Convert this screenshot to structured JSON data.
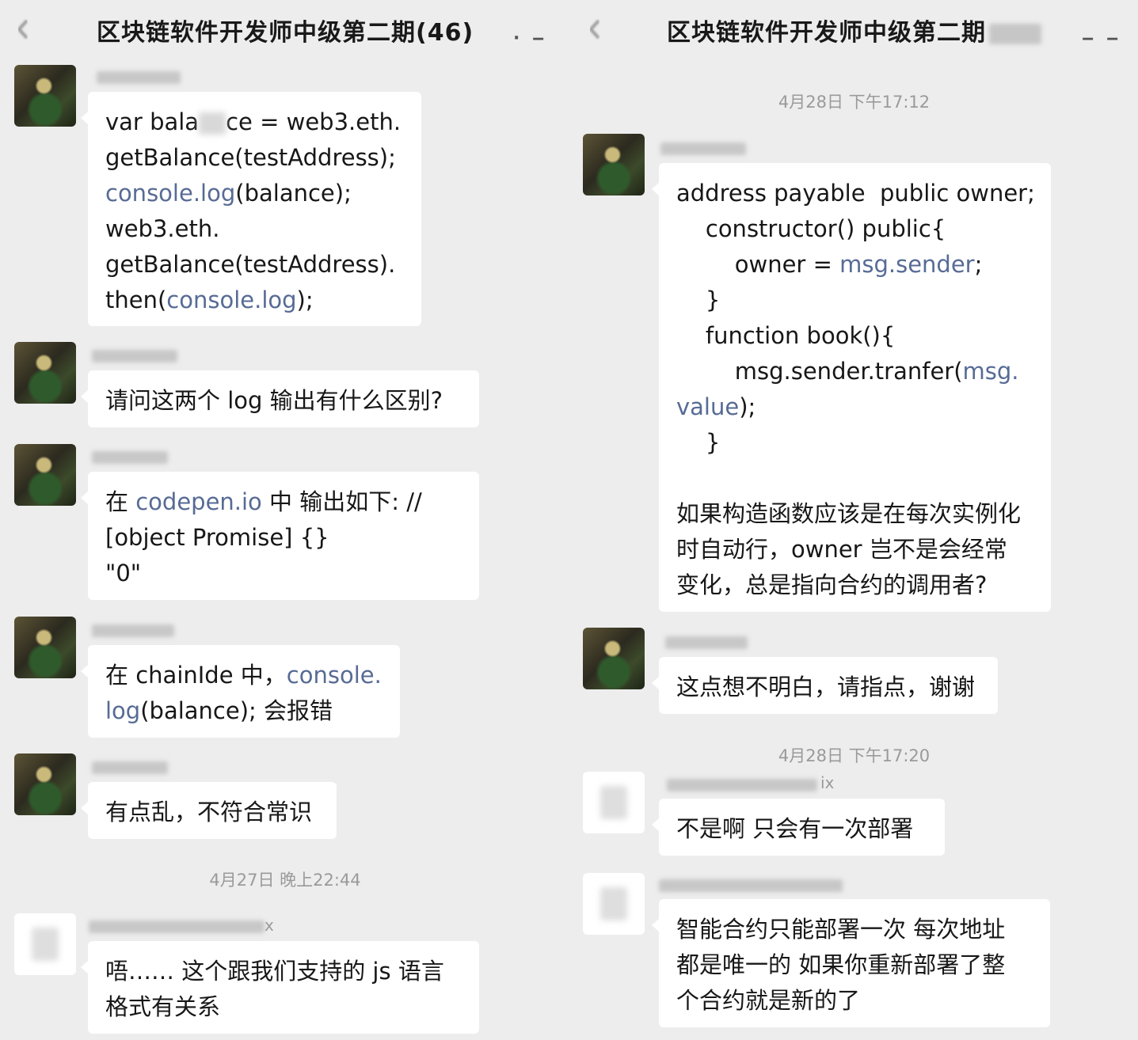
{
  "left": {
    "title": "区块链软件开发师中级第二期(46)",
    "more_icon": "more-dots",
    "timestamp": "4月27日 晚上22:44",
    "messages": [
      {
        "lines": [
          "var bala",
          "ce = web3.eth.",
          "getBala",
          "nce(testAddress);",
          "console",
          "log",
          "(balance);",
          "web3.eth.",
          "getBalance(testAddress).",
          "then(",
          "console.log",
          ");"
        ]
      },
      {
        "text": "请问这两个 log 输出有什么区别?"
      },
      {
        "pre": "在 ",
        "link": "codepen.io",
        "post": " 中 输出如下: //\n[object Promise] {}\n\"0\""
      },
      {
        "pre": "在 chainIde 中，",
        "link": "console.\nlog",
        "post": "(balance); 会报错"
      },
      {
        "text": "有点乱，不符合常识"
      },
      {
        "sender_suffix": "x",
        "text": "唔…… 这个跟我们支持的 js 语言\n格式有关系"
      }
    ]
  },
  "right": {
    "title": "区块链软件开发师中级第二期",
    "more_icon": "more-dots",
    "timestamp1": "4月28日 下午17:12",
    "timestamp2": "4月28日 下午17:20",
    "code": {
      "l1": "address payable  public owner;",
      "l2": "    constructor() public{",
      "l3a": "        owner = ",
      "l3link": "msg.sender",
      "l3b": ";",
      "l4": "    }",
      "l5": "    function book(){",
      "l6a": "        msg.sender.tranfer(",
      "l6link": "msg.",
      "l7link": "value",
      "l7b": ");",
      "l8": "    }",
      "question": "如果构造函数应该是在每次实例化\n时自动行，owner 岂不是会经常\n变化，总是指向合约的调用者?"
    },
    "msg2": "这点想不明白，请指点，谢谢",
    "sender3_suffix": "ix",
    "msg3": "不是啊 只会有一次部署",
    "msg4": "智能合约只能部署一次 每次地址\n都是唯一的 如果你重新部署了整\n个合约就是新的了"
  }
}
